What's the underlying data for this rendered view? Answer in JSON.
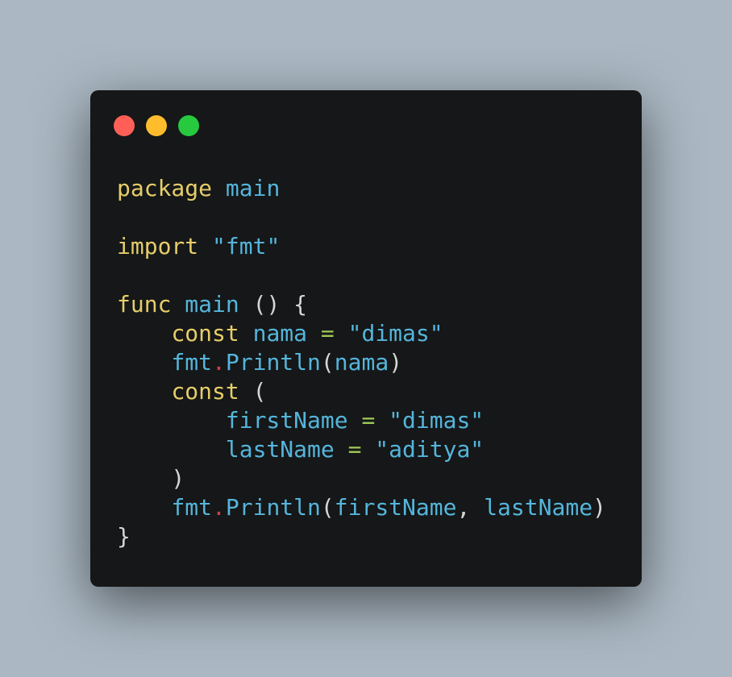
{
  "theme": {
    "background": "#abb8c3",
    "window_bg": "#151718",
    "dot_colors": [
      "#ff5f56",
      "#ffbd2e",
      "#27c93f"
    ],
    "token_colors": {
      "keyword": "#e6cd69",
      "ident": "#55b5db",
      "string": "#55b5db",
      "punct": "#d4d7d6",
      "operator": "#9fca56",
      "dot": "#cd3f45"
    }
  },
  "window_controls": [
    {
      "name": "close",
      "icon": "red-circle"
    },
    {
      "name": "minimize",
      "icon": "yellow-circle"
    },
    {
      "name": "maximize",
      "icon": "green-circle"
    }
  ],
  "code_lines": [
    [
      {
        "text": "package",
        "type": "keyword"
      },
      {
        "text": " ",
        "type": "punct"
      },
      {
        "text": "main",
        "type": "ident"
      }
    ],
    [],
    [
      {
        "text": "import",
        "type": "keyword"
      },
      {
        "text": " ",
        "type": "punct"
      },
      {
        "text": "\"fmt\"",
        "type": "string"
      }
    ],
    [],
    [
      {
        "text": "func",
        "type": "keyword"
      },
      {
        "text": " ",
        "type": "punct"
      },
      {
        "text": "main",
        "type": "ident"
      },
      {
        "text": " () {",
        "type": "punct"
      }
    ],
    [
      {
        "text": "    ",
        "type": "punct"
      },
      {
        "text": "const",
        "type": "keyword"
      },
      {
        "text": " ",
        "type": "punct"
      },
      {
        "text": "nama",
        "type": "ident"
      },
      {
        "text": " ",
        "type": "punct"
      },
      {
        "text": "=",
        "type": "operator"
      },
      {
        "text": " ",
        "type": "punct"
      },
      {
        "text": "\"dimas\"",
        "type": "string"
      }
    ],
    [
      {
        "text": "    ",
        "type": "punct"
      },
      {
        "text": "fmt",
        "type": "ident"
      },
      {
        "text": ".",
        "type": "dot"
      },
      {
        "text": "Println",
        "type": "ident"
      },
      {
        "text": "(",
        "type": "punct"
      },
      {
        "text": "nama",
        "type": "ident"
      },
      {
        "text": ")",
        "type": "punct"
      }
    ],
    [
      {
        "text": "    ",
        "type": "punct"
      },
      {
        "text": "const",
        "type": "keyword"
      },
      {
        "text": " (",
        "type": "punct"
      }
    ],
    [
      {
        "text": "        ",
        "type": "punct"
      },
      {
        "text": "firstName",
        "type": "ident"
      },
      {
        "text": " ",
        "type": "punct"
      },
      {
        "text": "=",
        "type": "operator"
      },
      {
        "text": " ",
        "type": "punct"
      },
      {
        "text": "\"dimas\"",
        "type": "string"
      }
    ],
    [
      {
        "text": "        ",
        "type": "punct"
      },
      {
        "text": "lastName",
        "type": "ident"
      },
      {
        "text": " ",
        "type": "punct"
      },
      {
        "text": "=",
        "type": "operator"
      },
      {
        "text": " ",
        "type": "punct"
      },
      {
        "text": "\"aditya\"",
        "type": "string"
      }
    ],
    [
      {
        "text": "    )",
        "type": "punct"
      }
    ],
    [
      {
        "text": "    ",
        "type": "punct"
      },
      {
        "text": "fmt",
        "type": "ident"
      },
      {
        "text": ".",
        "type": "dot"
      },
      {
        "text": "Println",
        "type": "ident"
      },
      {
        "text": "(",
        "type": "punct"
      },
      {
        "text": "firstName",
        "type": "ident"
      },
      {
        "text": ", ",
        "type": "punct"
      },
      {
        "text": "lastName",
        "type": "ident"
      },
      {
        "text": ")",
        "type": "punct"
      }
    ],
    [
      {
        "text": "}",
        "type": "punct"
      }
    ]
  ]
}
